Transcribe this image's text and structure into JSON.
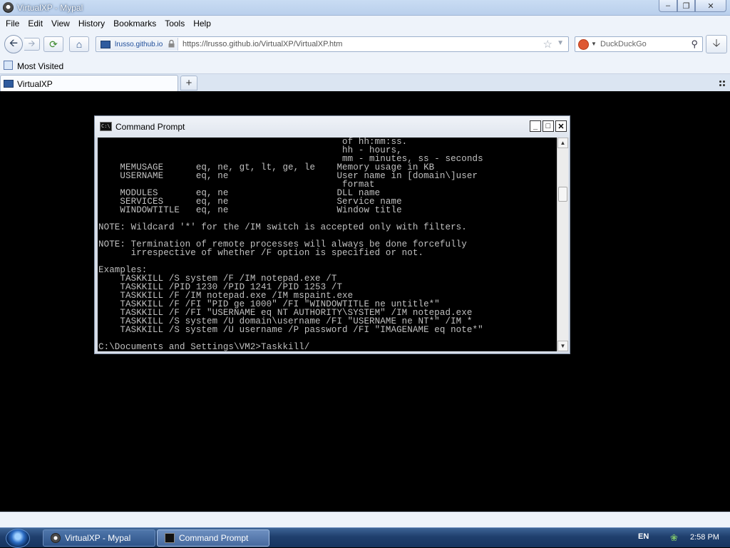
{
  "browser": {
    "window_title": "VirtualXP - Mypal",
    "menu": [
      "File",
      "Edit",
      "View",
      "History",
      "Bookmarks",
      "Tools",
      "Help"
    ],
    "identity_site": "lrusso.github.io",
    "url": "https://lrusso.github.io/VirtualXP/VirtualXP.htm",
    "search_placeholder": "DuckDuckGo",
    "bookmark": "Most Visited",
    "tab_label": "VirtualXP",
    "new_tab": "+"
  },
  "cmd": {
    "title": "Command Prompt",
    "lines": [
      "                                             of hh:mm:ss.",
      "                                             hh - hours,",
      "                                             mm - minutes, ss - seconds",
      "    MEMUSAGE      eq, ne, gt, lt, ge, le    Memory usage in KB",
      "    USERNAME      eq, ne                    User name in [domain\\]user",
      "                                             format",
      "    MODULES       eq, ne                    DLL name",
      "    SERVICES      eq, ne                    Service name",
      "    WINDOWTITLE   eq, ne                    Window title",
      "",
      "NOTE: Wildcard '*' for the /IM switch is accepted only with filters.",
      "",
      "NOTE: Termination of remote processes will always be done forcefully",
      "      irrespective of whether /F option is specified or not.",
      "",
      "Examples:",
      "    TASKKILL /S system /F /IM notepad.exe /T",
      "    TASKKILL /PID 1230 /PID 1241 /PID 1253 /T",
      "    TASKKILL /F /IM notepad.exe /IM mspaint.exe",
      "    TASKKILL /F /FI \"PID ge 1000\" /FI \"WINDOWTITLE ne untitle*\"",
      "    TASKKILL /F /FI \"USERNAME eq NT AUTHORITY\\SYSTEM\" /IM notepad.exe",
      "    TASKKILL /S system /U domain\\username /FI \"USERNAME ne NT*\" /IM *",
      "    TASKKILL /S system /U username /P password /FI \"IMAGENAME eq note*\"",
      "",
      "C:\\Documents and Settings\\VM2>Taskkill/"
    ]
  },
  "taskbar": {
    "tasks": [
      "VirtualXP - Mypal",
      "Command Prompt"
    ],
    "language": "EN",
    "clock": "2:58 PM"
  }
}
